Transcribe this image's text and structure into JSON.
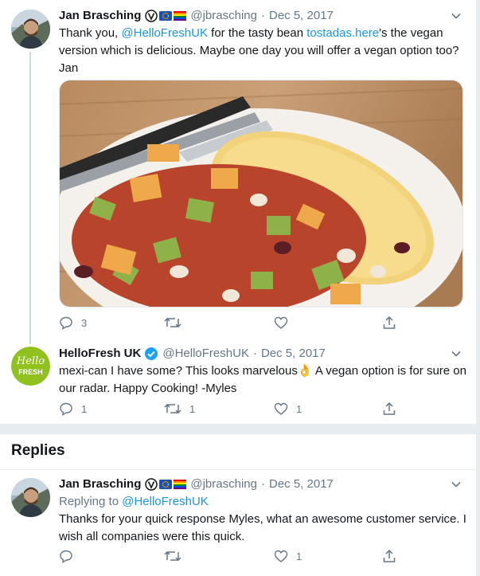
{
  "thread": {
    "tweet1": {
      "name": "Jan Brasching",
      "handle": "@jbrasching",
      "separator": "·",
      "date": "Dec 5, 2017",
      "text_pre": "Thank you, ",
      "mention": "@HelloFreshUK",
      "text_mid": " for the tasty bean ",
      "link": "tostadas.here",
      "text_post": "'s the vegan version which is delicious. Maybe one day you will offer a vegan option too? Jan",
      "reply_count": "3",
      "retweet_count": "",
      "like_count": ""
    },
    "tweet2": {
      "name": "HelloFresh UK",
      "handle": "@HelloFreshUK",
      "separator": "·",
      "date": "Dec 5, 2017",
      "text": "mexi-can I have some? This looks marvelous👌 A vegan option is for sure on our radar. Happy Cooking! -Myles",
      "avatar_text_1": "Hello",
      "avatar_text_2": "FRESH",
      "reply_count": "1",
      "retweet_count": "1",
      "like_count": "1"
    }
  },
  "replies": {
    "title": "Replies",
    "tweet3": {
      "name": "Jan Brasching",
      "handle": "@jbrasching",
      "separator": "·",
      "date": "Dec 5, 2017",
      "replying_label": "Replying to ",
      "replying_to": "@HelloFreshUK",
      "text": "Thanks for your quick response Myles, what an awesome customer service. I wish all companies were this quick.",
      "reply_count": "",
      "retweet_count": "",
      "like_count": "1"
    }
  },
  "icons": {
    "reply": "reply-icon",
    "retweet": "retweet-icon",
    "like": "heart-icon",
    "share": "share-icon",
    "more": "chevron-down-icon",
    "verified": "verified-badge-icon"
  },
  "colors": {
    "link": "#1b95e0",
    "secondary_text": "#657786",
    "hellofresh_green": "#91c11e",
    "background": "#e6ecf0"
  }
}
